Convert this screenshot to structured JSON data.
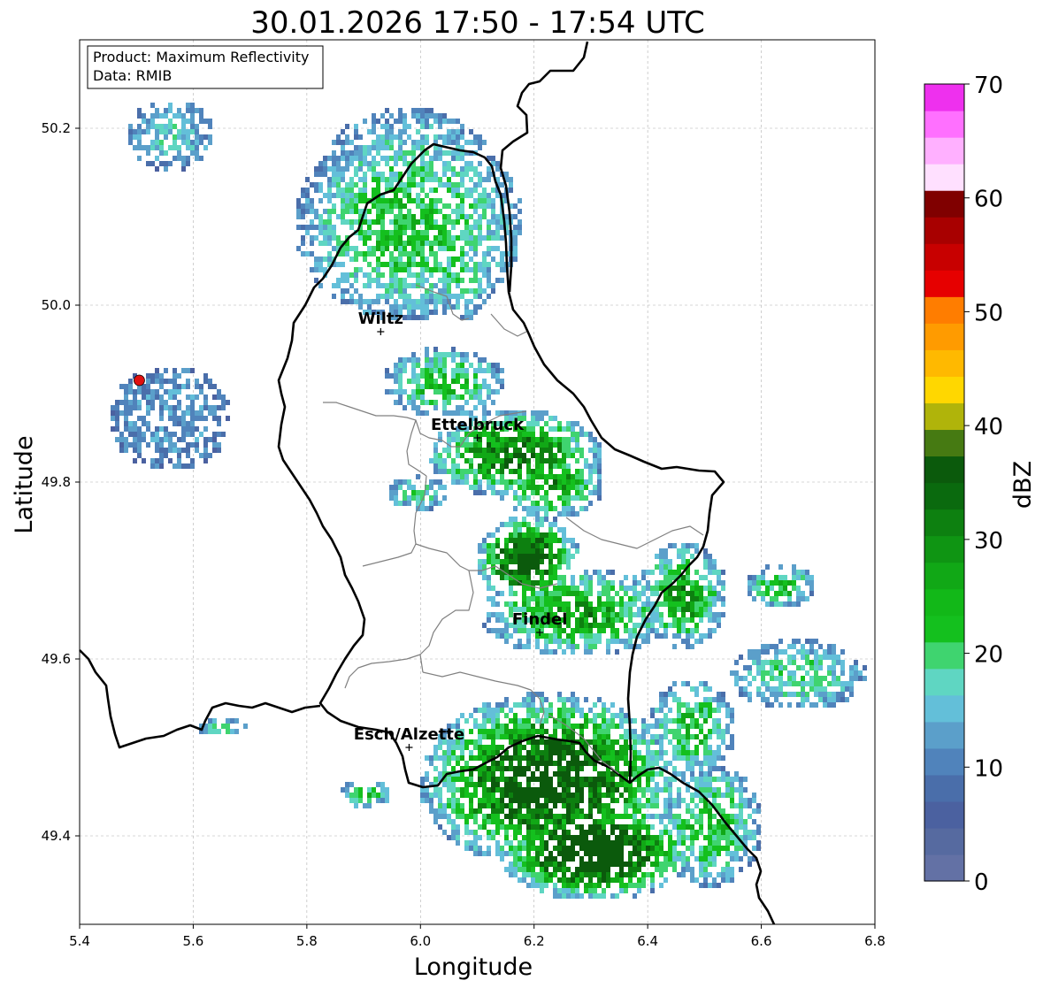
{
  "title": "30.01.2026 17:50 - 17:54 UTC",
  "info_box": {
    "product": "Product: Maximum Reflectivity",
    "data": "Data: RMIB"
  },
  "axes": {
    "xlabel": "Longitude",
    "ylabel": "Latitude",
    "xlim": [
      5.4,
      6.8
    ],
    "ylim": [
      49.3,
      50.3
    ],
    "xticks": [
      "5.4",
      "5.6",
      "5.8",
      "6.0",
      "6.2",
      "6.4",
      "6.6",
      "6.8"
    ],
    "yticks": [
      "49.4",
      "49.6",
      "49.8",
      "50.0",
      "50.2"
    ],
    "grid": true
  },
  "cities": [
    {
      "name": "Wiltz",
      "lon": 5.93,
      "lat": 49.97
    },
    {
      "name": "Ettelbruck",
      "lon": 6.1,
      "lat": 49.85
    },
    {
      "name": "Findel",
      "lon": 6.21,
      "lat": 49.63
    },
    {
      "name": "Esch/Alzette",
      "lon": 5.98,
      "lat": 49.5
    }
  ],
  "radar_site": {
    "lon": 5.505,
    "lat": 49.915,
    "color": "#e01010"
  },
  "colorbar": {
    "label": "dBZ",
    "min": 0,
    "max": 70,
    "ticks": [
      "0",
      "10",
      "20",
      "30",
      "40",
      "50",
      "60",
      "70"
    ],
    "colors": [
      "#6371a5",
      "#566aa0",
      "#4b61a0",
      "#4a6eaa",
      "#5083bb",
      "#5b9fca",
      "#63bfd9",
      "#5fd6c2",
      "#3fd46f",
      "#14c01e",
      "#12b818",
      "#11a816",
      "#0f9513",
      "#0d8010",
      "#0a6a0e",
      "#0b5a0c",
      "#467a12",
      "#b0b40a",
      "#ffd700",
      "#ffb900",
      "#ff9b00",
      "#ff7d00",
      "#e60000",
      "#c80000",
      "#a80000",
      "#800000",
      "#ffe0ff",
      "#ffb0ff",
      "#ff70ff",
      "#ee30ee"
    ]
  }
}
